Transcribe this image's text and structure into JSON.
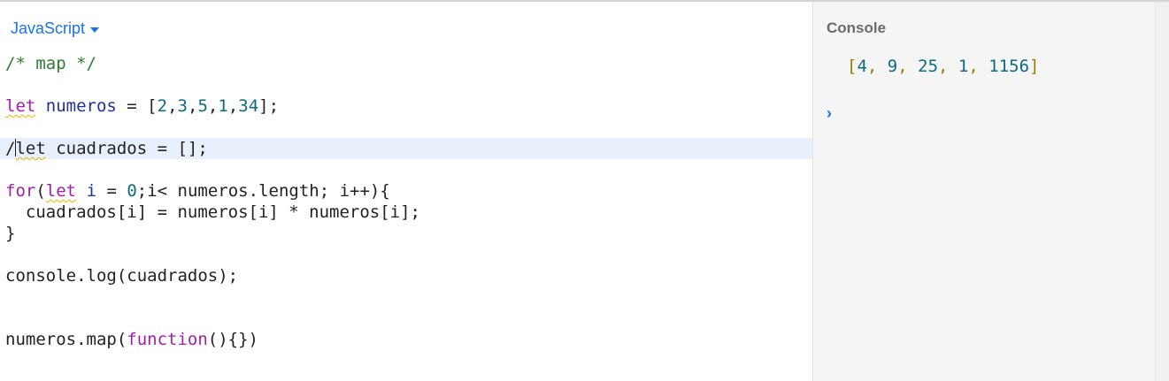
{
  "editor": {
    "language_label": "JavaScript",
    "lines": [
      {
        "parts": [
          {
            "t": "/* map */",
            "c": "cm-comment"
          }
        ]
      },
      {
        "parts": [
          {
            "t": "let",
            "c": "cm-keyword squiggle"
          },
          {
            "t": " "
          },
          {
            "t": "numeros",
            "c": "cm-var"
          },
          {
            "t": " = ["
          },
          {
            "t": "2",
            "c": "cm-num"
          },
          {
            "t": ","
          },
          {
            "t": "3",
            "c": "cm-num"
          },
          {
            "t": ","
          },
          {
            "t": "5",
            "c": "cm-num"
          },
          {
            "t": ","
          },
          {
            "t": "1",
            "c": "cm-num"
          },
          {
            "t": ","
          },
          {
            "t": "34",
            "c": "cm-num"
          },
          {
            "t": "];"
          }
        ]
      },
      {
        "active": true,
        "parts": [
          {
            "t": "/"
          },
          {
            "cursor": true
          },
          {
            "t": "let",
            "c": "squiggle"
          },
          {
            "t": " cuadrados = [];"
          }
        ]
      },
      {
        "parts": [
          {
            "t": "for",
            "c": "cm-keyword"
          },
          {
            "t": "("
          },
          {
            "t": "let",
            "c": "cm-keyword squiggle"
          },
          {
            "t": " "
          },
          {
            "t": "i",
            "c": "cm-var"
          },
          {
            "t": " = "
          },
          {
            "t": "0",
            "c": "cm-num"
          },
          {
            "t": ";i< numeros.length; i++){"
          }
        ]
      },
      {
        "parts": [
          {
            "t": "  cuadrados[i] = numeros[i] * numeros[i];"
          }
        ]
      },
      {
        "parts": [
          {
            "t": "}"
          }
        ]
      },
      {
        "parts": [
          {
            "t": "console.log(cuadrados);"
          }
        ]
      },
      {
        "parts": [
          {
            "t": "numeros.map("
          },
          {
            "t": "function",
            "c": "cm-keyword"
          },
          {
            "t": "(){})"
          }
        ]
      }
    ]
  },
  "console": {
    "title": "Console",
    "output": [
      {
        "t": "[",
        "c": "out-punct"
      },
      {
        "t": "4",
        "c": "out-num"
      },
      {
        "t": ", ",
        "c": "out-punct"
      },
      {
        "t": "9",
        "c": "out-num"
      },
      {
        "t": ", ",
        "c": "out-punct"
      },
      {
        "t": "25",
        "c": "out-num"
      },
      {
        "t": ", ",
        "c": "out-punct"
      },
      {
        "t": "1",
        "c": "out-num"
      },
      {
        "t": ", ",
        "c": "out-punct"
      },
      {
        "t": "1156",
        "c": "out-num"
      },
      {
        "t": "]",
        "c": "out-punct"
      }
    ],
    "prompt_symbol": "›"
  }
}
